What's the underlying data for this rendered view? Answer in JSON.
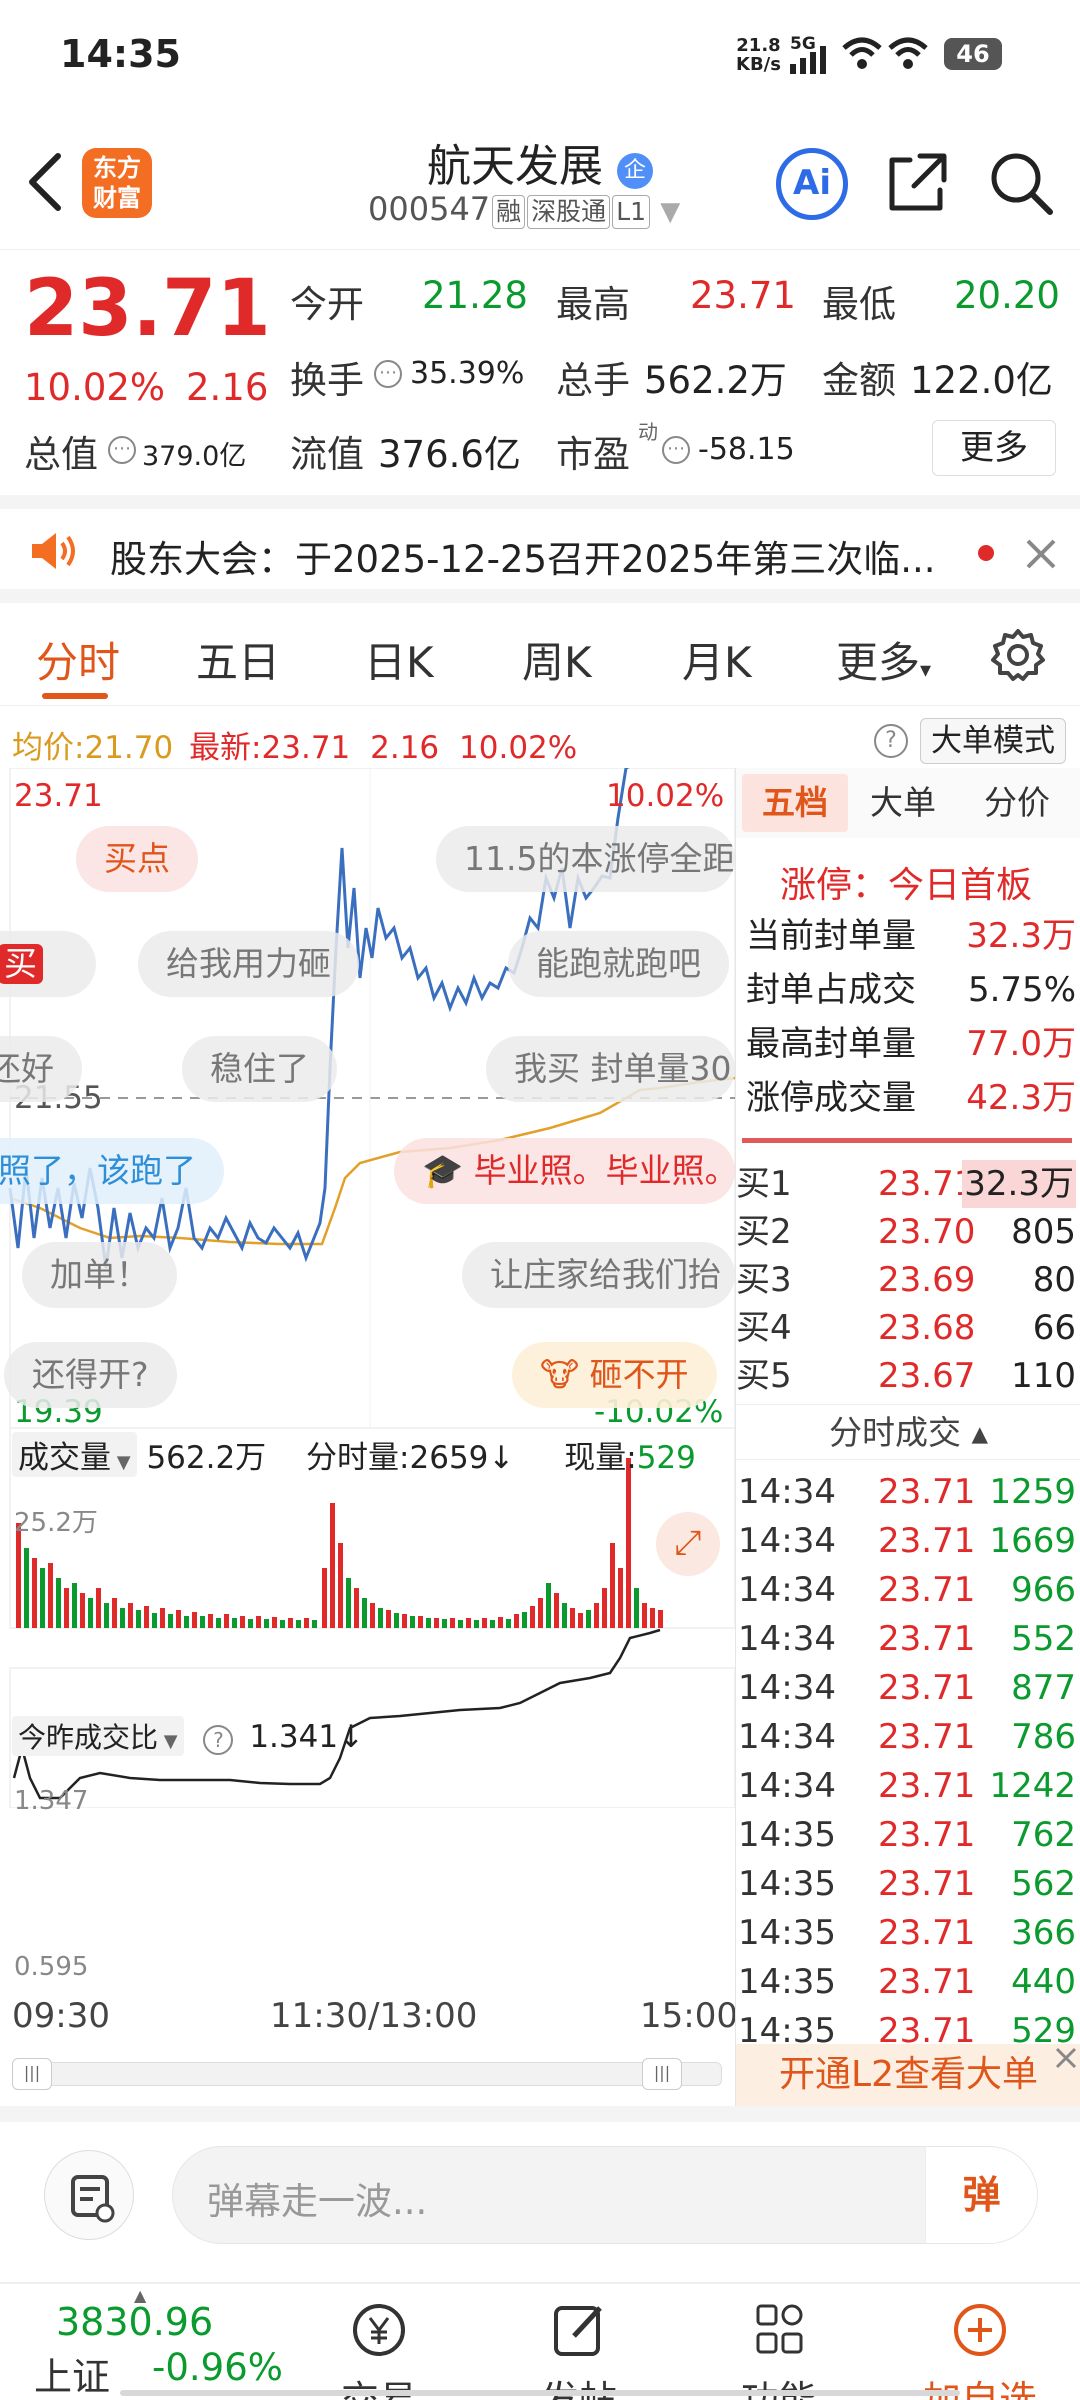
{
  "status": {
    "time": "14:35",
    "net_speed": "21.8",
    "net_unit": "KB/s",
    "signal": "5G",
    "battery": "46"
  },
  "header": {
    "brand": [
      "东方",
      "财富"
    ],
    "stock_name": "航天发展",
    "stock_code": "000547",
    "tags": [
      "融",
      "深股通",
      "L1"
    ],
    "ai_label": "Ai"
  },
  "quote": {
    "price": "23.71",
    "change_pct": "10.02%",
    "change": "2.16",
    "open_label": "今开",
    "open": "21.28",
    "high_label": "最高",
    "high": "23.71",
    "low_label": "最低",
    "low": "20.20",
    "turnover_label": "换手",
    "turnover": "35.39%",
    "volume_label": "总手",
    "volume": "562.2万",
    "amount_label": "金额",
    "amount": "122.0亿",
    "total_value_label": "总值",
    "total_value": "379.0亿",
    "float_value_label": "流值",
    "float_value": "376.6亿",
    "pe_label": "市盈",
    "pe_sup": "动",
    "pe": "-58.15",
    "more": "更多"
  },
  "notice": {
    "text": "股东大会：于2025-12-25召开2025年第三次临..."
  },
  "tabs": [
    "分时",
    "五日",
    "日K",
    "周K",
    "月K",
    "更多"
  ],
  "chart_info": {
    "avg_label": "均价:",
    "avg": "21.70",
    "latest_label": "最新:",
    "latest": "23.71",
    "change": "2.16",
    "change_pct": "10.02%",
    "mode_button": "大单模式"
  },
  "chart_labels": {
    "top_price": "23.71",
    "top_pct": "10.02%",
    "mid_price": "21.55",
    "bottom_price": "19.39",
    "bottom_pct": "-10.02%"
  },
  "danmaku": [
    "买点",
    "11.5的本涨停全距",
    "给我用力砸",
    "能跑就跑吧",
    "买",
    "还好",
    "稳住了",
    "我买 封单量30",
    "照了，该跑了",
    "毕业照。毕业照。",
    "加单！",
    "让庄家给我们抬",
    "还得开?",
    "砸不开"
  ],
  "volume_bar": {
    "label": "成交量",
    "total": "562.2万",
    "minute_label": "分时量:",
    "minute": "2659",
    "now_label": "现量:",
    "now": "529",
    "max": "25.2万"
  },
  "ratio": {
    "label": "今昨成交比",
    "value": "1.341",
    "max": "1.347",
    "min": "0.595"
  },
  "time_axis": [
    "09:30",
    "11:30/13:00",
    "15:00"
  ],
  "side": {
    "tabs": [
      "五档",
      "大单",
      "分价"
    ],
    "limit_title": "涨停：今日首板",
    "limit_rows": [
      {
        "label": "当前封单量",
        "value": "32.3万"
      },
      {
        "label": "封单占成交",
        "value": "5.75%"
      },
      {
        "label": "最高封单量",
        "value": "77.0万"
      },
      {
        "label": "涨停成交量",
        "value": "42.3万"
      }
    ],
    "bids": [
      {
        "label": "买1",
        "price": "23.71",
        "vol": "32.3万"
      },
      {
        "label": "买2",
        "price": "23.70",
        "vol": "805"
      },
      {
        "label": "买3",
        "price": "23.69",
        "vol": "80"
      },
      {
        "label": "买4",
        "price": "23.68",
        "vol": "66"
      },
      {
        "label": "买5",
        "price": "23.67",
        "vol": "110"
      }
    ],
    "trades_title": "分时成交",
    "trades": [
      {
        "t": "14:34",
        "p": "23.71",
        "v": "1259"
      },
      {
        "t": "14:34",
        "p": "23.71",
        "v": "1669"
      },
      {
        "t": "14:34",
        "p": "23.71",
        "v": "966"
      },
      {
        "t": "14:34",
        "p": "23.71",
        "v": "552"
      },
      {
        "t": "14:34",
        "p": "23.71",
        "v": "877"
      },
      {
        "t": "14:34",
        "p": "23.71",
        "v": "786"
      },
      {
        "t": "14:34",
        "p": "23.71",
        "v": "1242"
      },
      {
        "t": "14:35",
        "p": "23.71",
        "v": "762"
      },
      {
        "t": "14:35",
        "p": "23.71",
        "v": "562"
      },
      {
        "t": "14:35",
        "p": "23.71",
        "v": "366"
      },
      {
        "t": "14:35",
        "p": "23.71",
        "v": "440"
      },
      {
        "t": "14:35",
        "p": "23.71",
        "v": "529"
      }
    ],
    "l2_banner": "开通L2查看大单"
  },
  "danmaku_input": {
    "placeholder": "弹幕走一波...",
    "send": "弹"
  },
  "bottom": {
    "index_value": "3830.96",
    "index_name": "上证",
    "index_change": "-0.96%",
    "trade": "交易",
    "post": "发帖",
    "func": "功能",
    "watch": "加自选"
  },
  "colors": {
    "up": "#e02a2a",
    "down": "#0a9a2e",
    "accent": "#f36d22",
    "avg_line": "#e2a02a",
    "price_line": "#3a6fbf"
  }
}
